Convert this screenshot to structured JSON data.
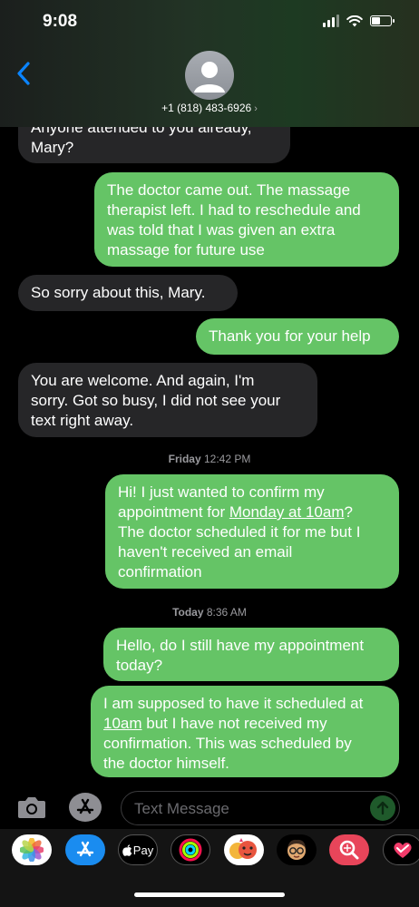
{
  "status_bar": {
    "time": "9:08"
  },
  "contact": {
    "name": "+1 (818) 483-6926",
    "chevron": "›"
  },
  "messages": [
    {
      "side": "in",
      "lines": [
        "Anyone attended to you already,",
        "Mary?"
      ]
    },
    {
      "side": "out",
      "lines": [
        "The doctor came out. The massage",
        "therapist left. I had to reschedule and",
        "was told that I was given an extra",
        "massage for future use"
      ]
    },
    {
      "side": "in",
      "lines": [
        "So sorry about this,  Mary."
      ]
    },
    {
      "side": "out",
      "lines": [
        "Thank you for your help"
      ]
    },
    {
      "side": "in",
      "lines": [
        "You are welcome. And again, I'm",
        "sorry. Got so busy, I did not see your",
        "text right away."
      ]
    },
    {
      "side": "out",
      "lines": [
        "Hi! I just wanted to confirm my",
        "appointment for ",
        "Monday at 10am",
        "?",
        "The doctor scheduled it for me but I",
        "haven't received an email",
        "confirmation"
      ]
    },
    {
      "side": "out",
      "lines": [
        "Hello, do I still have my appointment",
        "today?"
      ]
    },
    {
      "side": "out",
      "lines": [
        "I am supposed to have it scheduled at",
        "10am",
        " but I have not received my",
        "confirmation. This was scheduled by",
        "the doctor himself."
      ]
    }
  ],
  "timestamps": [
    {
      "day": "Friday",
      "time": "12:42 PM"
    },
    {
      "day": "Today",
      "time": "8:36 AM"
    }
  ],
  "input": {
    "placeholder": "Text Message"
  },
  "apps": [
    {
      "icon": "photos-icon"
    },
    {
      "icon": "app-store-icon"
    },
    {
      "icon": "apple-pay-icon",
      "label": "Pay"
    },
    {
      "icon": "activity-icon"
    },
    {
      "icon": "memoji-stickers-icon"
    },
    {
      "icon": "memoji-icon"
    },
    {
      "icon": "image-search-icon"
    },
    {
      "icon": "digital-touch-icon"
    }
  ],
  "colors": {
    "incoming_bubble": "#262628",
    "outgoing_bubble": "#65c466",
    "link_blue": "#0a84ff"
  }
}
